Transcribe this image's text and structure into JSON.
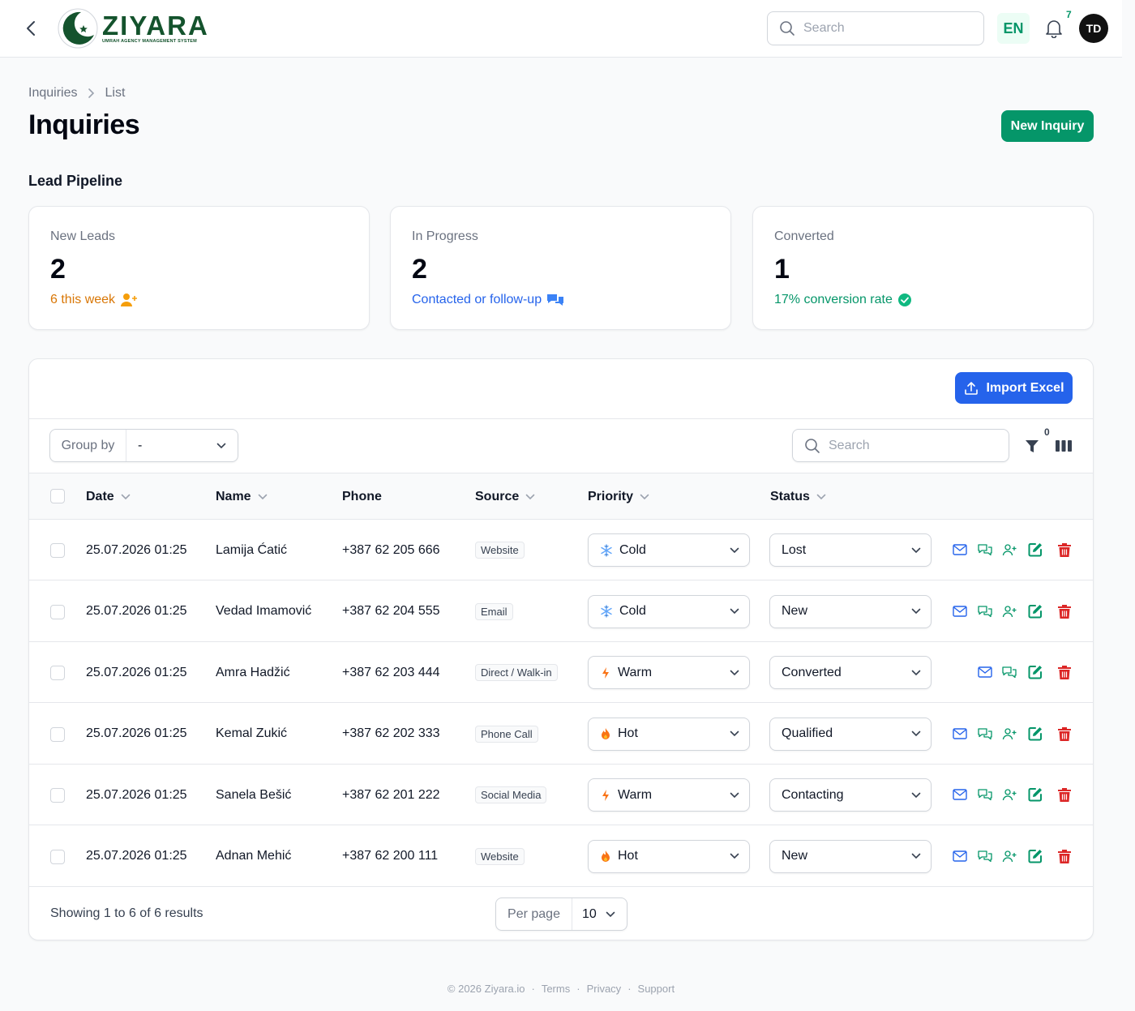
{
  "brand": {
    "name": "ZIYARA",
    "tagline": "UMRAH AGENCY MANAGEMENT SYSTEM"
  },
  "topbar": {
    "search_placeholder": "Search",
    "language": "EN",
    "notifications_count": "7",
    "avatar_initials": "TD"
  },
  "breadcrumb": [
    "Inquiries",
    "List"
  ],
  "page_title": "Inquiries",
  "new_button": "New Inquiry",
  "section_title": "Lead Pipeline",
  "stats": [
    {
      "label": "New Leads",
      "value": "2",
      "desc": "6 this week",
      "icon": "user-plus-icon",
      "color": "#d97706"
    },
    {
      "label": "In Progress",
      "value": "2",
      "desc": "Contacted or follow-up",
      "icon": "chat-bubbles-icon",
      "color": "#2563eb"
    },
    {
      "label": "Converted",
      "value": "1",
      "desc": "17% conversion rate",
      "icon": "check-badge-icon",
      "color": "#059669"
    }
  ],
  "import_button": "Import Excel",
  "group_by": {
    "label": "Group by",
    "value": "-"
  },
  "table_search_placeholder": "Search",
  "filter_count": "0",
  "columns": {
    "date": "Date",
    "name": "Name",
    "phone": "Phone",
    "source": "Source",
    "priority": "Priority",
    "status": "Status"
  },
  "rows": [
    {
      "date": "25.07.2026 01:25",
      "name": "Lamija Ćatić",
      "phone": "+387 62 205 666",
      "source": "Website",
      "priority": "Cold",
      "priority_icon": "snowflake-icon",
      "status": "Lost",
      "can_convert": true
    },
    {
      "date": "25.07.2026 01:25",
      "name": "Vedad Imamović",
      "phone": "+387 62 204 555",
      "source": "Email",
      "priority": "Cold",
      "priority_icon": "snowflake-icon",
      "status": "New",
      "can_convert": true
    },
    {
      "date": "25.07.2026 01:25",
      "name": "Amra Hadžić",
      "phone": "+387 62 203 444",
      "source": "Direct / Walk-in",
      "priority": "Warm",
      "priority_icon": "bolt-icon",
      "status": "Converted",
      "can_convert": false
    },
    {
      "date": "25.07.2026 01:25",
      "name": "Kemal Zukić",
      "phone": "+387 62 202 333",
      "source": "Phone Call",
      "priority": "Hot",
      "priority_icon": "fire-icon",
      "status": "Qualified",
      "can_convert": true
    },
    {
      "date": "25.07.2026 01:25",
      "name": "Sanela Bešić",
      "phone": "+387 62 201 222",
      "source": "Social Media",
      "priority": "Warm",
      "priority_icon": "bolt-icon",
      "status": "Contacting",
      "can_convert": true
    },
    {
      "date": "25.07.2026 01:25",
      "name": "Adnan Mehić",
      "phone": "+387 62 200 111",
      "source": "Website",
      "priority": "Hot",
      "priority_icon": "fire-icon",
      "status": "New",
      "can_convert": true
    }
  ],
  "results_text": "Showing 1 to 6 of 6 results",
  "per_page": {
    "label": "Per page",
    "value": "10"
  },
  "footer": [
    "© 2026 Ziyara.io",
    "Terms",
    "Privacy",
    "Support"
  ],
  "colors": {
    "primary": "#059669",
    "blue": "#2563eb",
    "danger": "#dc2626",
    "brand": "#14532d"
  }
}
